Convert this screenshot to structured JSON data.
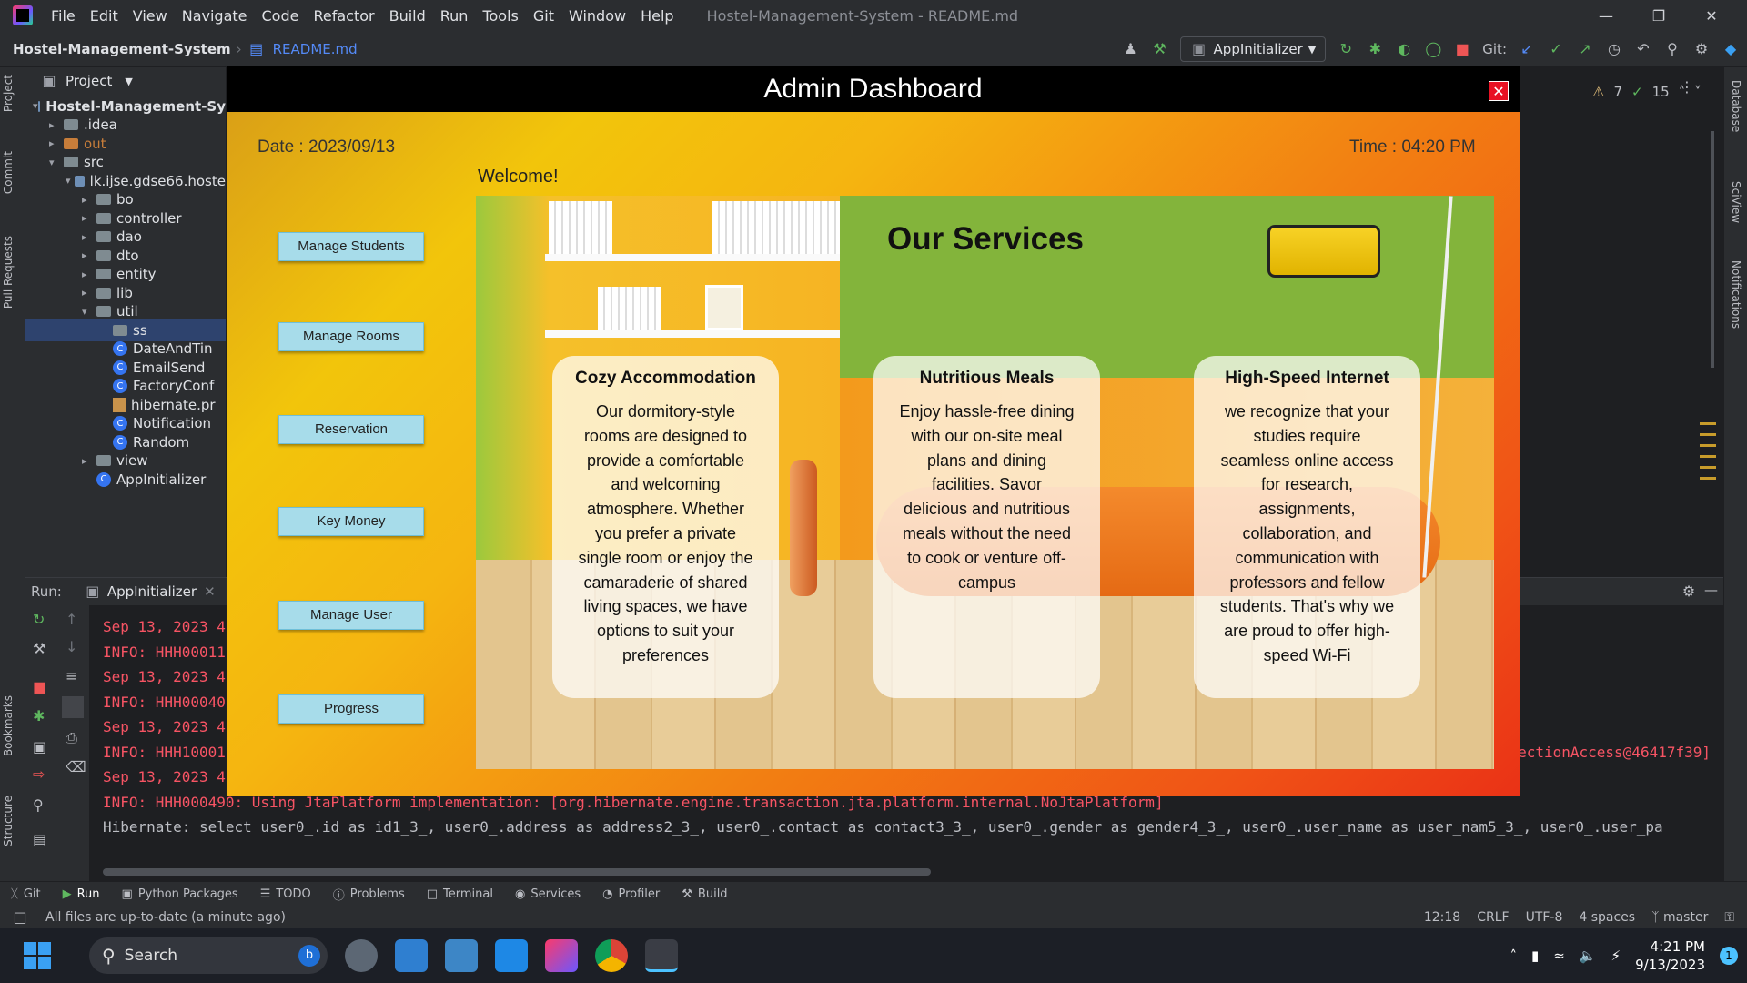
{
  "ide": {
    "menu": [
      "File",
      "Edit",
      "View",
      "Navigate",
      "Code",
      "Refactor",
      "Build",
      "Run",
      "Tools",
      "Git",
      "Window",
      "Help"
    ],
    "window_title": "Hostel-Management-System - README.md",
    "breadcrumb_project": "Hostel-Management-System",
    "breadcrumb_file": "README.md",
    "run_config": "AppInitializer",
    "git_label": "Git:",
    "warnings": "7",
    "checks": "15",
    "project_label": "Project",
    "tree": [
      {
        "label": "Hostel-Management-Sy",
        "indent": 0,
        "type": "root"
      },
      {
        "label": ".idea",
        "indent": 1,
        "type": "folder"
      },
      {
        "label": "out",
        "indent": 1,
        "type": "folder-out"
      },
      {
        "label": "src",
        "indent": 1,
        "type": "folder-open"
      },
      {
        "label": "lk.ijse.gdse66.hoste",
        "indent": 2,
        "type": "folder-open"
      },
      {
        "label": "bo",
        "indent": 3,
        "type": "folder"
      },
      {
        "label": "controller",
        "indent": 3,
        "type": "folder"
      },
      {
        "label": "dao",
        "indent": 3,
        "type": "folder"
      },
      {
        "label": "dto",
        "indent": 3,
        "type": "folder"
      },
      {
        "label": "entity",
        "indent": 3,
        "type": "folder"
      },
      {
        "label": "lib",
        "indent": 3,
        "type": "folder"
      },
      {
        "label": "util",
        "indent": 3,
        "type": "folder-open"
      },
      {
        "label": "ss",
        "indent": 4,
        "type": "folder-sel"
      },
      {
        "label": "DateAndTin",
        "indent": 4,
        "type": "class"
      },
      {
        "label": "EmailSend",
        "indent": 4,
        "type": "class"
      },
      {
        "label": "FactoryConf",
        "indent": 4,
        "type": "class"
      },
      {
        "label": "hibernate.pr",
        "indent": 4,
        "type": "props"
      },
      {
        "label": "Notification",
        "indent": 4,
        "type": "class"
      },
      {
        "label": "Random",
        "indent": 4,
        "type": "class"
      },
      {
        "label": "view",
        "indent": 3,
        "type": "folder"
      },
      {
        "label": "AppInitializer",
        "indent": 3,
        "type": "class"
      }
    ],
    "run_label": "Run:",
    "run_tab": "AppInitializer",
    "console": [
      {
        "text": "Sep 13, 2023 4",
        "cls": "red"
      },
      {
        "text": "INFO: HHH00011",
        "cls": "red"
      },
      {
        "text": "Sep 13, 2023 4",
        "cls": "red"
      },
      {
        "text": "INFO: HHH00040",
        "cls": "red"
      },
      {
        "text": "Sep 13, 2023 4",
        "cls": "red"
      },
      {
        "text": "INFO: HHH10001",
        "cls": "red"
      },
      {
        "text": "Sep 13, 2023 4",
        "cls": "red"
      },
      {
        "text": "INFO: HHH000490: Using JtaPlatform implementation: [org.hibernate.engine.transaction.jta.platform.internal.NoJtaPlatform]",
        "cls": "red"
      },
      {
        "text": "Hibernate: select user0_.id as id1_3_, user0_.address as address2_3_, user0_.contact as contact3_3_, user0_.gender as gender4_3_, user0_.user_name as user_nam5_3_, user0_.user_pa",
        "cls": "wht"
      }
    ],
    "console_right": "ectionAccess@46417f39]",
    "tool_tabs": [
      "Git",
      "Run",
      "Python Packages",
      "TODO",
      "Problems",
      "Terminal",
      "Services",
      "Profiler",
      "Build"
    ],
    "status_left": "All files are up-to-date (a minute ago)",
    "status_right": [
      "12:18",
      "CRLF",
      "UTF-8",
      "4 spaces",
      "master"
    ],
    "left_tabs": [
      "Project",
      "Commit",
      "Pull Requests",
      "Bookmarks",
      "Structure"
    ],
    "right_tabs": [
      "Database",
      "SciView",
      "Notifications"
    ]
  },
  "dashboard": {
    "title": "Admin Dashboard",
    "close": "✕",
    "date": "Date : 2023/09/13",
    "time": "Time : 04:20 PM",
    "welcome": "Welcome!",
    "buttons": [
      "Manage Students",
      "Manage Rooms",
      "Reservation",
      "Key Money",
      "Manage User",
      "Progress"
    ],
    "services_title": "Our Services",
    "cards": [
      {
        "title": "Cozy Accommodation",
        "lines": [
          "Our dormitory-style",
          "rooms are designed to",
          "provide a comfortable",
          "and welcoming",
          "atmosphere. Whether",
          "you prefer a private",
          "single room or enjoy the",
          "camaraderie of shared",
          "living spaces, we have",
          "options to suit your",
          "preferences"
        ]
      },
      {
        "title": "Nutritious Meals",
        "lines": [
          "Enjoy hassle-free dining",
          "with our on-site meal",
          "plans and dining",
          "facilities. Savor",
          "delicious and nutritious",
          "meals without the need",
          "to cook or venture off-",
          "campus"
        ]
      },
      {
        "title": "High-Speed Internet",
        "lines": [
          "we recognize that your",
          "studies require",
          "seamless online access",
          "for research,",
          "assignments,",
          "collaboration, and",
          "communication with",
          "professors and fellow",
          "students. That's why we",
          "are proud to offer high-",
          "speed Wi-Fi"
        ]
      }
    ]
  },
  "taskbar": {
    "search": "Search",
    "time": "4:21 PM",
    "date": "9/13/2023",
    "badge": "1"
  },
  "colors": {
    "accent": "#3574f0",
    "dash_btn": "#a7dcea",
    "close": "#e81123"
  }
}
